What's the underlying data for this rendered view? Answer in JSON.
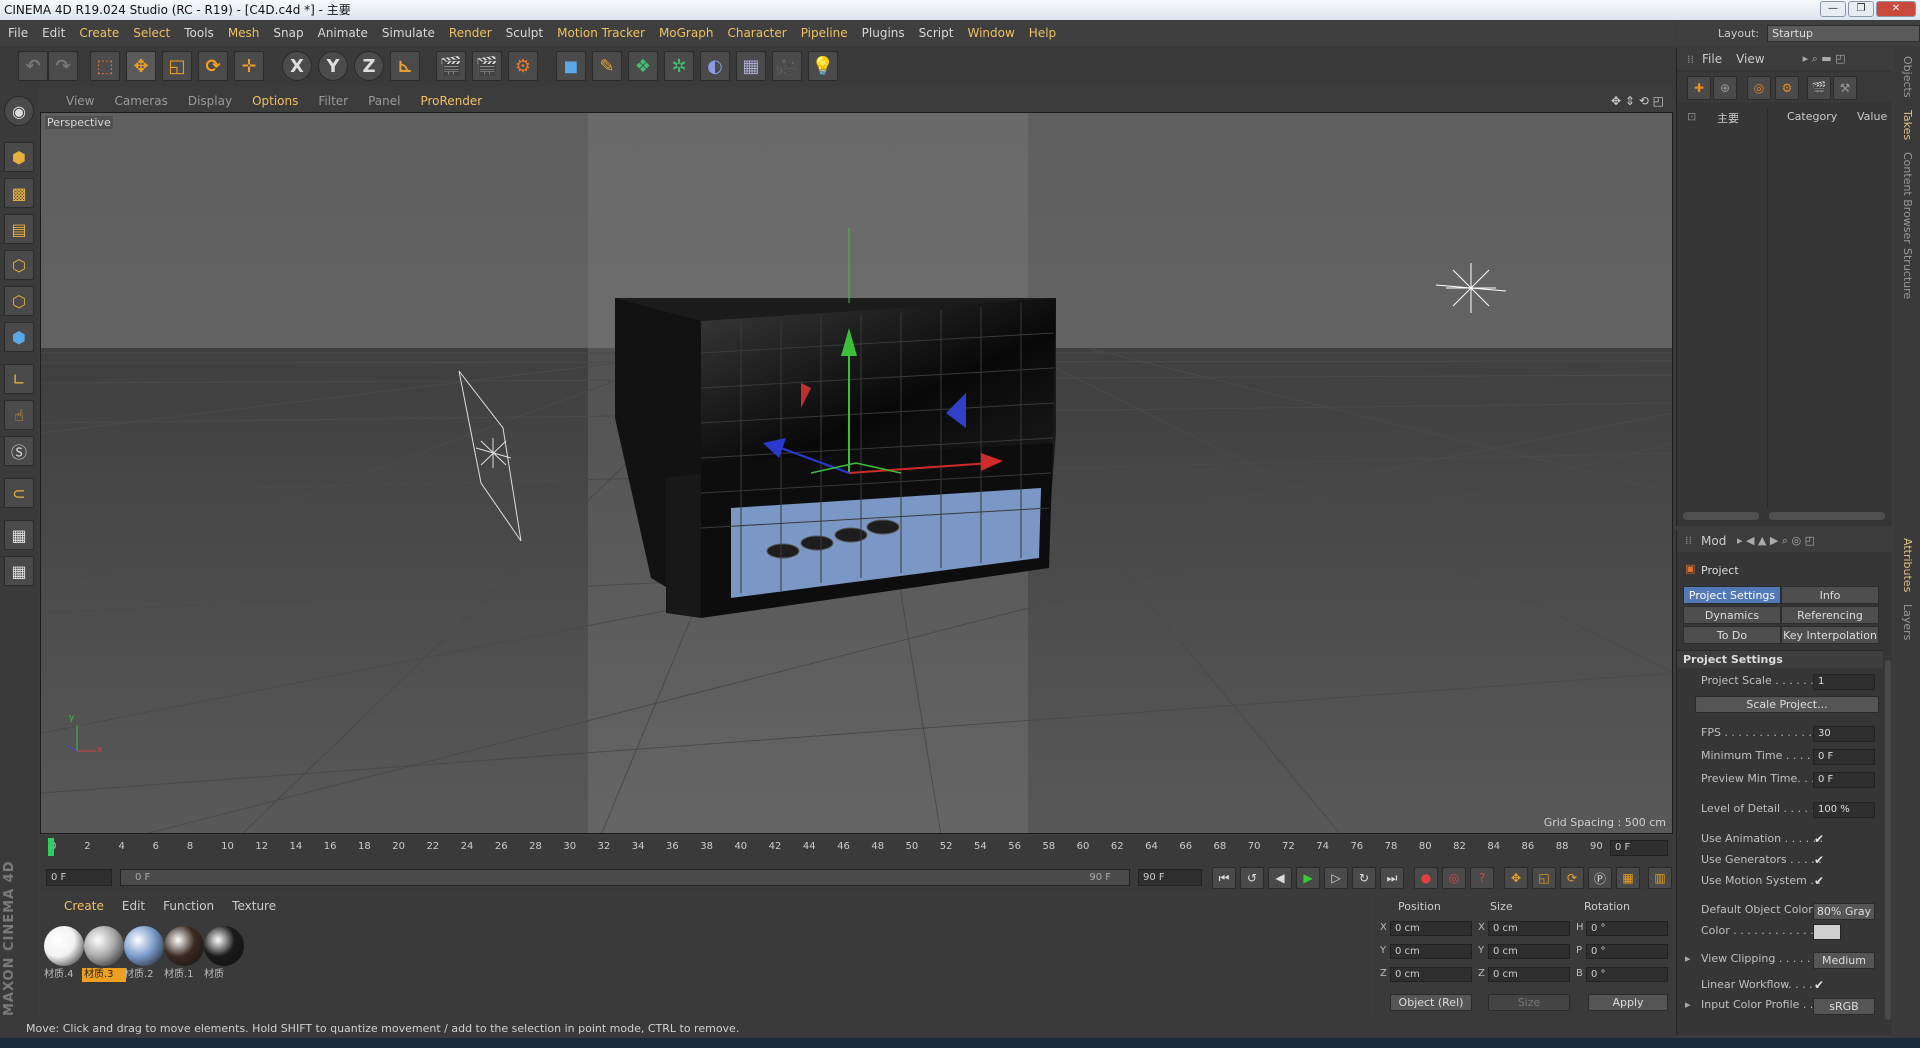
{
  "window": {
    "title": "CINEMA 4D R19.024 Studio (RC - R19) - [C4D.c4d *] - 主要",
    "buttons": [
      "—",
      "❐",
      "✕"
    ]
  },
  "menubar": {
    "items": [
      "File",
      "Edit",
      "Create",
      "Select",
      "Tools",
      "Mesh",
      "Snap",
      "Animate",
      "Simulate",
      "Render",
      "Sculpt",
      "Motion Tracker",
      "MoGraph",
      "Character",
      "Pipeline",
      "Plugins",
      "Script",
      "Window",
      "Help"
    ],
    "layout_label": "Layout:",
    "layout_value": "Startup"
  },
  "toolbar": {
    "axis_x": "X",
    "axis_y": "Y",
    "axis_z": "Z"
  },
  "viewport": {
    "menu": [
      "View",
      "Cameras",
      "Display",
      "Options",
      "Filter",
      "Panel",
      "ProRender"
    ],
    "highlight_menu": "Options",
    "label": "Perspective",
    "grid_spacing": "Grid Spacing : 500 cm",
    "axis_x": "x",
    "axis_y": "y"
  },
  "timeline": {
    "ticks": [
      "0",
      "2",
      "4",
      "6",
      "8",
      "10",
      "12",
      "14",
      "16",
      "18",
      "20",
      "22",
      "24",
      "26",
      "28",
      "30",
      "32",
      "34",
      "36",
      "38",
      "40",
      "42",
      "44",
      "46",
      "48",
      "50",
      "52",
      "54",
      "56",
      "58",
      "60",
      "62",
      "64",
      "66",
      "68",
      "70",
      "72",
      "74",
      "76",
      "78",
      "80",
      "82",
      "84",
      "86",
      "88",
      "90"
    ],
    "current_frame": "0 F",
    "start_field": "0 F",
    "range_start": "0 F",
    "range_end": "90 F",
    "end_field": "90 F"
  },
  "materials": {
    "menu": [
      "Create",
      "Edit",
      "Function",
      "Texture"
    ],
    "items": [
      {
        "name": "材质.4",
        "color": "#f2f2f2"
      },
      {
        "name": "材质.3",
        "color": "#a9a9a9"
      },
      {
        "name": "材质.2",
        "color": "#7b9ccc"
      },
      {
        "name": "材质.1",
        "color": "#3a2a22"
      },
      {
        "name": "材质",
        "color": "#1a1a1a"
      }
    ],
    "selected_index": 1
  },
  "coordinates": {
    "headers": {
      "position": "Position",
      "size": "Size",
      "rotation": "Rotation"
    },
    "rows": [
      {
        "pl": "X",
        "pv": "0 cm",
        "sl": "X",
        "sv": "0 cm",
        "rl": "H",
        "rv": "0 °"
      },
      {
        "pl": "Y",
        "pv": "0 cm",
        "sl": "Y",
        "sv": "0 cm",
        "rl": "P",
        "rv": "0 °"
      },
      {
        "pl": "Z",
        "pv": "0 cm",
        "sl": "Z",
        "sv": "0 cm",
        "rl": "B",
        "rv": "0 °"
      }
    ],
    "mode": "Object (Rel)",
    "size_mode": "Size",
    "apply": "Apply"
  },
  "status": "Move: Click and drag to move elements. Hold SHIFT to quantize movement / add to the selection in point mode, CTRL to remove.",
  "brand": "MAXON CINEMA 4D",
  "object_manager": {
    "menu": [
      "File",
      "View"
    ],
    "root_name": "主要",
    "col_category": "Category",
    "col_value": "Value"
  },
  "attributes": {
    "menu": "Mod",
    "object_name": "Project",
    "tabs": [
      "Project Settings",
      "Info",
      "Dynamics",
      "Referencing",
      "To Do",
      "Key Interpolation"
    ],
    "active_tab": "Project Settings",
    "section": "Project Settings",
    "rows": {
      "project_scale": {
        "label": "Project Scale . . . . . . .",
        "value": "1"
      },
      "scale_project": "Scale Project...",
      "fps": {
        "label": "FPS . . . . . . . . . . . . . .",
        "value": "30"
      },
      "min_time": {
        "label": "Minimum Time . . . . . .",
        "value": "0 F"
      },
      "preview_min": {
        "label": "Preview Min Time. . . .",
        "value": "0 F"
      },
      "lod": {
        "label": "Level of Detail . . . . . .",
        "value": "100 %"
      },
      "use_animation": {
        "label": "Use Animation . . . . . .",
        "value": "✔"
      },
      "use_generators": {
        "label": "Use Generators . . . . .",
        "value": "✔"
      },
      "use_motion": {
        "label": "Use Motion System . .",
        "value": "✔"
      },
      "default_color": {
        "label": "Default Object Color",
        "value": "80% Gray"
      },
      "color": {
        "label": "Color . . . . . . . . . . . .",
        "swatch": "#cfcfcf"
      },
      "view_clipping": {
        "label": "View Clipping . . . . . .",
        "value": "Medium"
      },
      "linear_workflow": {
        "label": "Linear Workflow. . . . .",
        "value": "✔"
      },
      "input_profile": {
        "label": "Input Color Profile . . .",
        "value": "sRGB"
      }
    }
  },
  "side_tabs": [
    "Objects",
    "Takes",
    "Content Browser",
    "Structure",
    "Attributes",
    "Layers"
  ]
}
